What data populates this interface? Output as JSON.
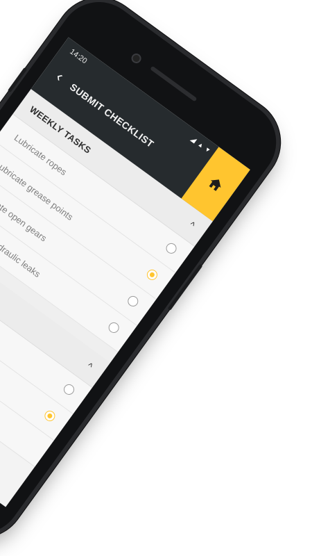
{
  "status_bar": {
    "time": "14:20",
    "icons": "◢ ▴ ▾"
  },
  "app_bar": {
    "title": "SUBMIT CHECKLIST",
    "back_icon": "chevron-left-icon",
    "home_icon": "home-icon"
  },
  "colors": {
    "accent": "#ffc52f",
    "app_bar_bg": "#262b2e",
    "screen_bg": "#f3f3f3"
  },
  "sections": [
    {
      "title": "WEEKLY TASKS",
      "expanded": true,
      "tasks": [
        {
          "label": "Lubricate ropes",
          "checked": false
        },
        {
          "label": "Lubricate grease points",
          "checked": true
        },
        {
          "label": "Lubricate open gears",
          "checked": false
        },
        {
          "label": "Check for hydraulic leaks",
          "checked": false
        }
      ]
    },
    {
      "title": "",
      "expanded": true,
      "tasks": [
        {
          "label": "",
          "checked": false
        },
        {
          "label": "",
          "checked": true
        }
      ]
    }
  ]
}
